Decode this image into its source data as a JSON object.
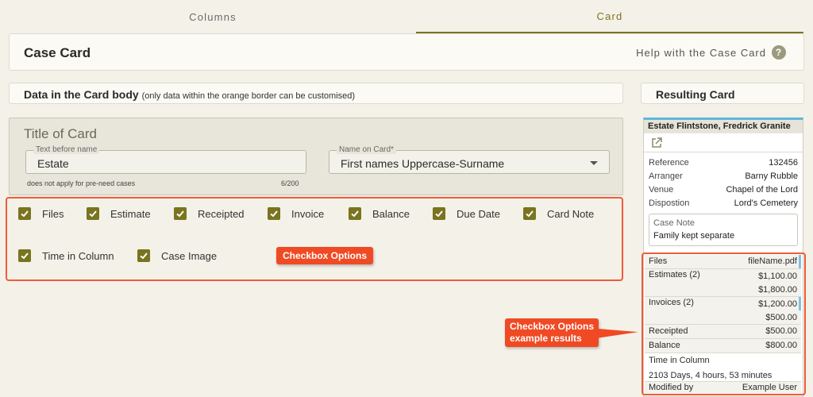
{
  "tabs": [
    {
      "label": "Columns",
      "active": false
    },
    {
      "label": "Card",
      "active": true
    }
  ],
  "header": {
    "title": "Case Card",
    "help_label": "Help with the Case Card",
    "help_icon": "question-circle-icon"
  },
  "data_section": {
    "title": "Data in the Card body",
    "subtitle": "(only data within the orange border can be customised)"
  },
  "result_section": {
    "title": "Resulting Card"
  },
  "title_of_card": {
    "heading": "Title of Card",
    "text_before_name": {
      "label": "Text before name",
      "value": "Estate"
    },
    "name_on_card": {
      "label": "Name on Card*",
      "value": "First names Uppercase-Surname"
    },
    "hint": "does not apply for pre-need cases",
    "counter": "6/200"
  },
  "checkboxes": [
    {
      "label": "Files",
      "checked": true
    },
    {
      "label": "Estimate",
      "checked": true
    },
    {
      "label": "Receipted",
      "checked": true
    },
    {
      "label": "Invoice",
      "checked": true
    },
    {
      "label": "Balance",
      "checked": true
    },
    {
      "label": "Due Date",
      "checked": true
    },
    {
      "label": "Card Note",
      "checked": true
    },
    {
      "label": "Time in Column",
      "checked": true
    },
    {
      "label": "Case Image",
      "checked": true
    }
  ],
  "callouts": {
    "checkbox_options": "Checkbox Options",
    "example_results_line1": "Checkbox Options",
    "example_results_line2": "example results"
  },
  "result_card": {
    "title": "Estate Flintstone, Fredrick Granite",
    "rows": [
      {
        "key": "Reference",
        "value": "132456"
      },
      {
        "key": "Arranger",
        "value": "Barny Rubble"
      },
      {
        "key": "Venue",
        "value": "Chapel of the Lord"
      },
      {
        "key": "Dispostion",
        "value": "Lord's Cemetery"
      }
    ],
    "note": {
      "label": "Case Note",
      "value": "Family kept separate"
    },
    "results": {
      "files": {
        "key": "Files",
        "value": "fileName.pdf"
      },
      "estimates": {
        "key": "Estimates (2)",
        "values": [
          "$1,100.00",
          "$1,800.00"
        ]
      },
      "invoices": {
        "key": "Invoices (2)",
        "values": [
          "$1,200.00",
          "$500.00"
        ]
      },
      "receipted": {
        "key": "Receipted",
        "value": "$500.00"
      },
      "balance": {
        "key": "Balance",
        "value": "$800.00"
      },
      "time_in_column": {
        "key": "Time in Column",
        "value": "2103 Days, 4 hours, 53 minutes"
      },
      "modified_by": {
        "key": "Modified by",
        "value": "Example User"
      }
    }
  },
  "colors": {
    "accent": "#79741f",
    "highlight_border": "#ef5b3a",
    "callout": "#f04a24",
    "card_top": "#5eb7dd"
  }
}
